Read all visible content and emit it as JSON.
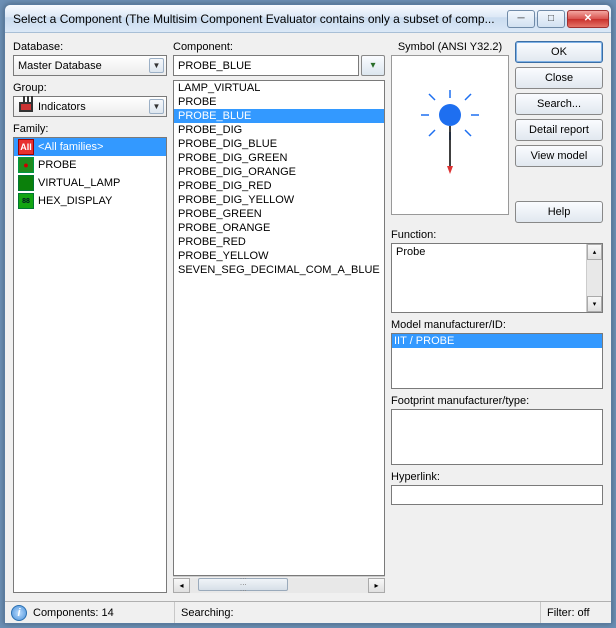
{
  "window": {
    "title": "Select a Component (The Multisim Component Evaluator contains only a subset of comp..."
  },
  "labels": {
    "database": "Database:",
    "group": "Group:",
    "family": "Family:",
    "component": "Component:",
    "symbol": "Symbol (ANSI Y32.2)",
    "function": "Function:",
    "model_mfr": "Model manufacturer/ID:",
    "footprint_mfr": "Footprint manufacturer/type:",
    "hyperlink": "Hyperlink:"
  },
  "database": {
    "selected": "Master Database"
  },
  "group": {
    "selected": "Indicators"
  },
  "families": [
    {
      "name": "<All families>",
      "icon": "all",
      "label": "All"
    },
    {
      "name": "PROBE",
      "icon": "probe"
    },
    {
      "name": "VIRTUAL_LAMP",
      "icon": "lamp"
    },
    {
      "name": "HEX_DISPLAY",
      "icon": "hex",
      "label": "88"
    }
  ],
  "component_input": "PROBE_BLUE",
  "components": [
    "LAMP_VIRTUAL",
    "PROBE",
    "PROBE_BLUE",
    "PROBE_DIG",
    "PROBE_DIG_BLUE",
    "PROBE_DIG_GREEN",
    "PROBE_DIG_ORANGE",
    "PROBE_DIG_RED",
    "PROBE_DIG_YELLOW",
    "PROBE_GREEN",
    "PROBE_ORANGE",
    "PROBE_RED",
    "PROBE_YELLOW",
    "SEVEN_SEG_DECIMAL_COM_A_BLUE"
  ],
  "components_selected_index": 2,
  "buttons": {
    "ok": "OK",
    "close": "Close",
    "search": "Search...",
    "detail": "Detail report",
    "view": "View model",
    "help": "Help"
  },
  "function_text": "Probe",
  "model_mfr_text": "IIT / PROBE",
  "status": {
    "components": "Components: 14",
    "searching": "Searching:",
    "filter": "Filter: off"
  }
}
